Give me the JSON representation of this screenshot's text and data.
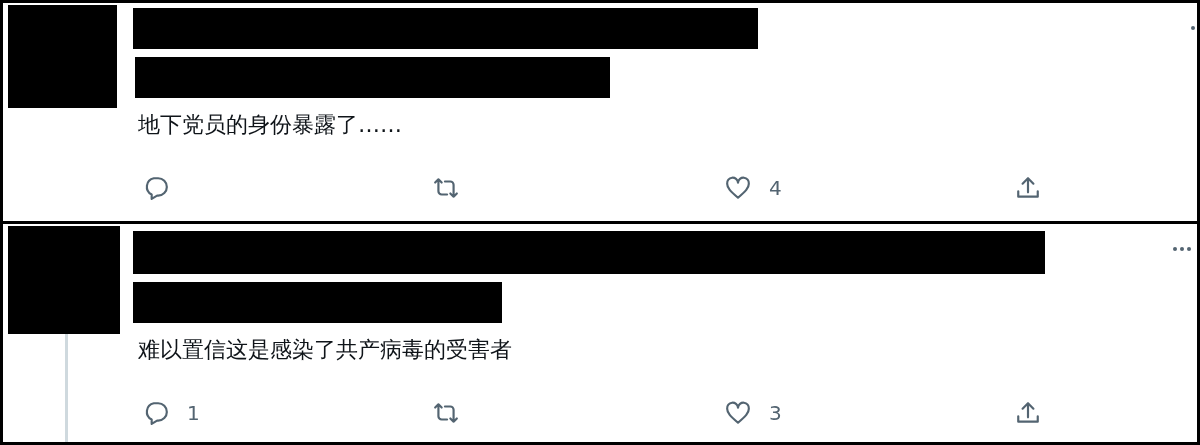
{
  "tweets": [
    {
      "text": "地下党员的身份暴露了……",
      "thread_line": false,
      "actions": [
        {
          "kind": "reply"
        },
        {
          "kind": "retweet"
        },
        {
          "kind": "like",
          "count": "4"
        },
        {
          "kind": "share"
        }
      ]
    },
    {
      "text": "难以置信这是感染了共产病毒的受害者",
      "thread_line": true,
      "actions": [
        {
          "kind": "reply",
          "count": "1"
        },
        {
          "kind": "retweet"
        },
        {
          "kind": "like",
          "count": "3"
        },
        {
          "kind": "share"
        }
      ]
    }
  ]
}
